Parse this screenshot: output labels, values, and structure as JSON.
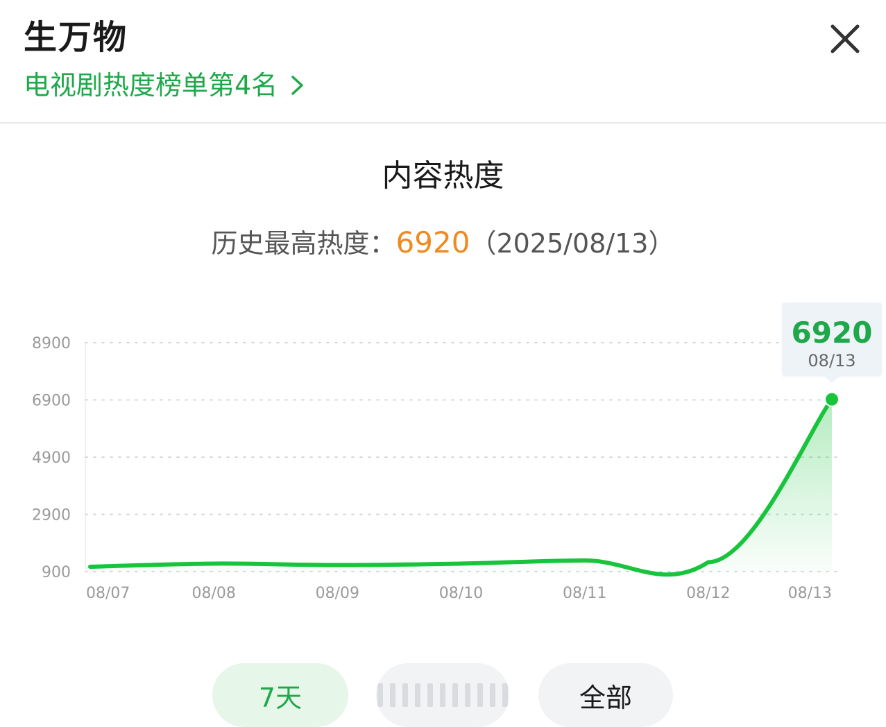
{
  "header": {
    "title": "生万物",
    "rank_link": "电视剧热度榜单第4名"
  },
  "icons": {
    "close": "close-icon",
    "rank_arrow": "chevron-right-icon"
  },
  "section": {
    "title": "内容热度",
    "peak_label": "历史最高热度：",
    "peak_value": "6920",
    "peak_date": "（2025/08/13）"
  },
  "colors": {
    "accent_green": "#1fa84a",
    "line_green": "#18c43c",
    "peak_orange": "#f08a1e"
  },
  "chart_data": {
    "type": "area",
    "title": "",
    "xlabel": "",
    "ylabel": "",
    "x": [
      "08/07",
      "08/08",
      "08/09",
      "08/10",
      "08/11",
      "08/12",
      "08/13"
    ],
    "values": [
      1070,
      1180,
      1130,
      1180,
      1290,
      1230,
      6920
    ],
    "yticks": [
      "8900",
      "6900",
      "4900",
      "2900",
      "900"
    ],
    "ylim": [
      900,
      8900
    ],
    "grid": true,
    "tooltip": {
      "value": "6920",
      "date": "08/13"
    }
  },
  "tabs": [
    {
      "label": "7天",
      "selected": true
    },
    {
      "label": "",
      "selected": false
    },
    {
      "label": "全部",
      "selected": false
    }
  ]
}
